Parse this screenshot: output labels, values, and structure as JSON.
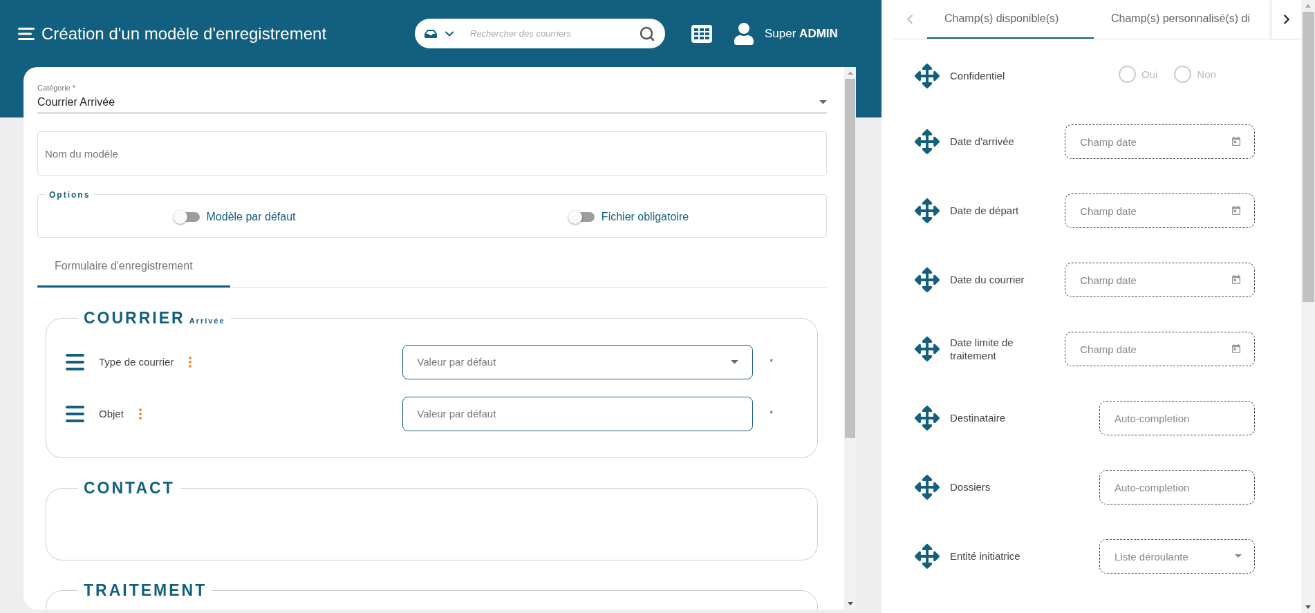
{
  "header": {
    "title": "Création d'un modèle d'enregistrement",
    "search": {
      "placeholder": "Rechercher des courriers"
    },
    "user": {
      "first_name": "Super",
      "last_name": "ADMIN"
    }
  },
  "form": {
    "category": {
      "label": "Catégorie *",
      "value": "Courrier Arrivée"
    },
    "name_field": {
      "placeholder": "Nom du modèle"
    },
    "options": {
      "title": "Options",
      "toggles": [
        {
          "label": "Modèle par défaut",
          "on": false
        },
        {
          "label": "Fichier obligatoire",
          "on": false
        }
      ]
    },
    "tabs": [
      {
        "label": "Formulaire d'enregistrement",
        "selected": true
      }
    ],
    "sections": [
      {
        "title": "COURRIER",
        "subtitle": "Arrivée",
        "fields": [
          {
            "label": "Type de courrier",
            "kind": "select",
            "placeholder": "Valeur par défaut",
            "mark": "*"
          },
          {
            "label": "Objet",
            "kind": "text",
            "placeholder": "Valeur par défaut",
            "mark": "*"
          }
        ]
      },
      {
        "title": "CONTACT"
      },
      {
        "title": "TRAITEMENT"
      }
    ]
  },
  "panel": {
    "tabs": [
      {
        "label": "Champ(s) disponible(s)",
        "selected": true
      },
      {
        "label": "Champ(s) personnalisé(s) di",
        "selected": false
      }
    ],
    "fields": [
      {
        "label": "Confidentiel",
        "kind": "radio",
        "options": [
          {
            "label": "Oui",
            "selected": false
          },
          {
            "label": "Non",
            "selected": false
          }
        ]
      },
      {
        "label": "Date d'arrivée",
        "kind": "date",
        "placeholder": "Champ date"
      },
      {
        "label": "Date de départ",
        "kind": "date",
        "placeholder": "Champ date"
      },
      {
        "label": "Date du courrier",
        "kind": "date",
        "placeholder": "Champ date"
      },
      {
        "label": "Date limite de traitement",
        "kind": "date",
        "placeholder": "Champ date"
      },
      {
        "label": "Destinataire",
        "kind": "autocomplete",
        "placeholder": "Auto-completion"
      },
      {
        "label": "Dossiers",
        "kind": "autocomplete",
        "placeholder": "Auto-completion"
      },
      {
        "label": "Entité initiatrice",
        "kind": "select",
        "placeholder": "Liste déroulante"
      }
    ]
  }
}
